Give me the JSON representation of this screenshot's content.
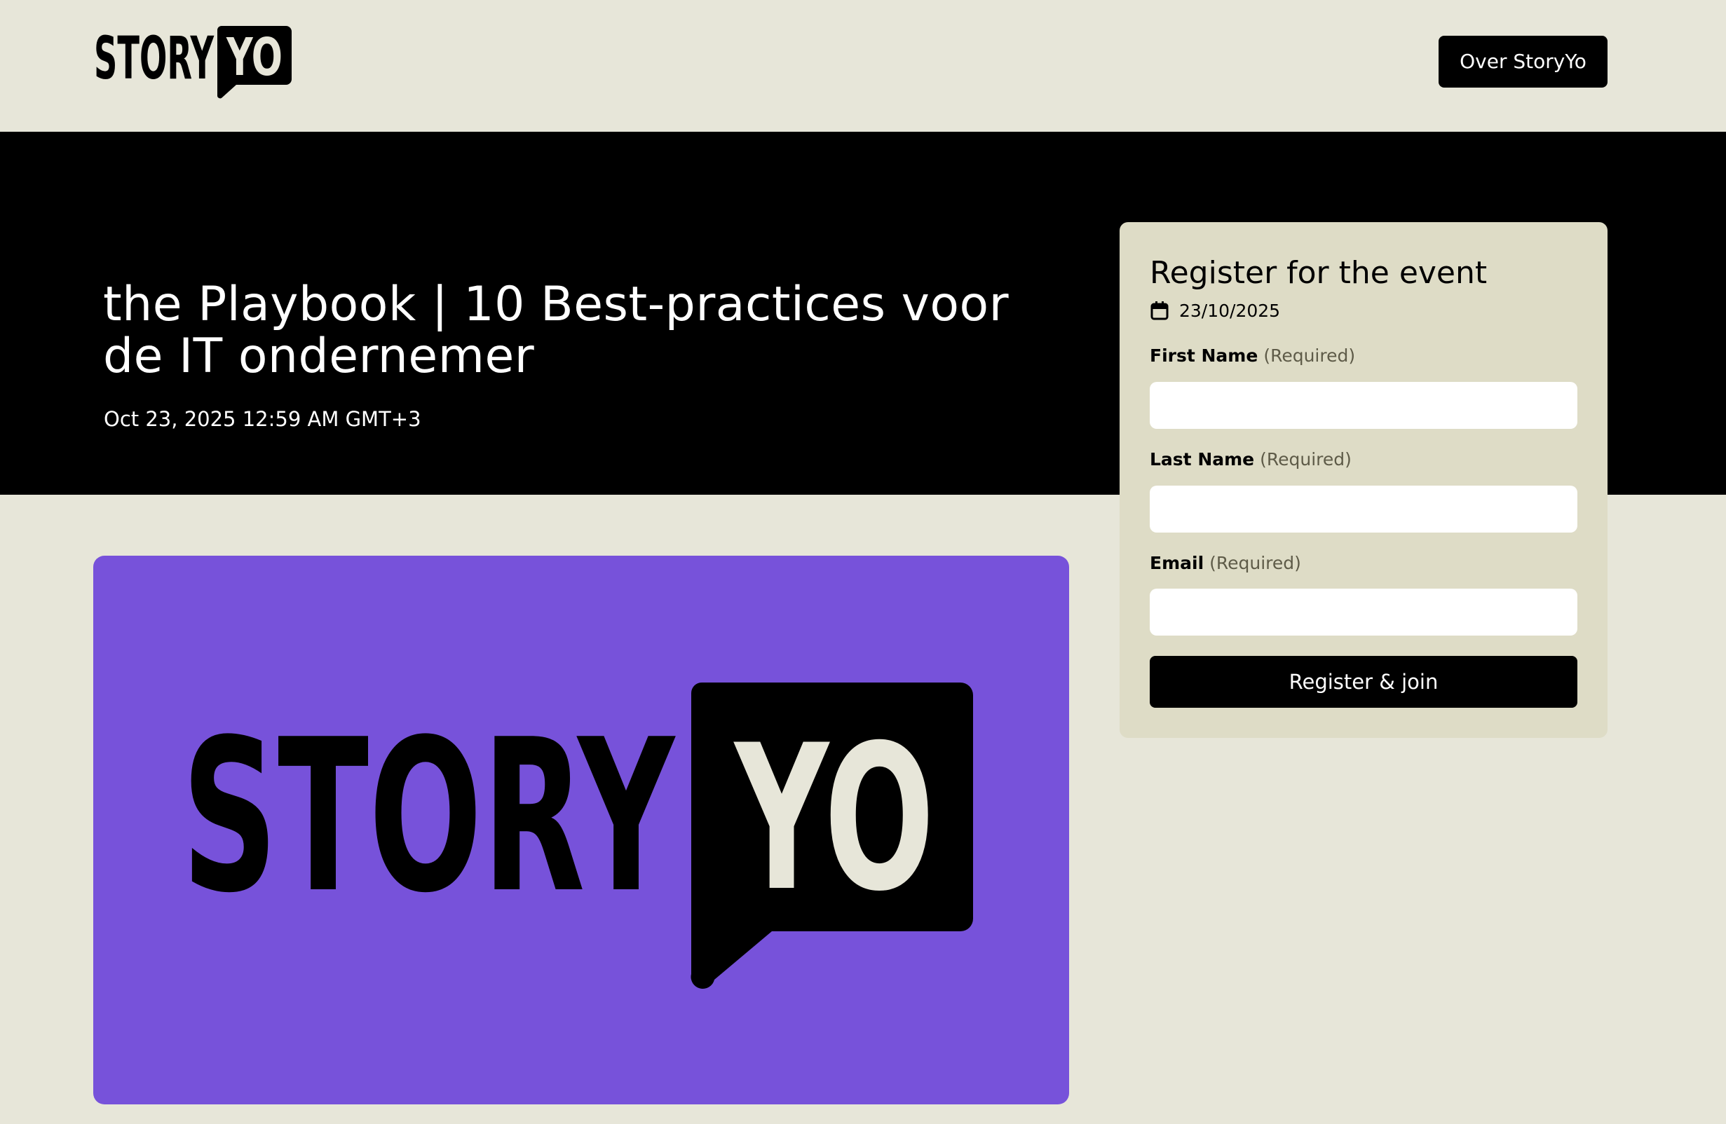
{
  "header": {
    "logo": {
      "part1": "STORY",
      "part2": "YO"
    },
    "about_button": "Over StoryYo"
  },
  "event": {
    "title": "the Playbook | 10 Best-practices voor de IT ondernemer",
    "datetime": "Oct 23, 2025 12:59 AM GMT+3"
  },
  "banner": {
    "logo": {
      "part1": "STORY",
      "part2": "YO"
    },
    "background_color": "#7752da"
  },
  "register": {
    "title": "Register for the event",
    "date": "23/10/2025",
    "date_icon": "calendar-icon",
    "fields": [
      {
        "label": "First Name",
        "required": "(Required)",
        "value": ""
      },
      {
        "label": "Last Name",
        "required": "(Required)",
        "value": ""
      },
      {
        "label": "Email",
        "required": "(Required)",
        "value": ""
      }
    ],
    "submit": "Register & join"
  },
  "colors": {
    "page_background": "#e7e6d9",
    "hero_background": "#000000",
    "card_background": "#dedcc6",
    "button_background": "#000000",
    "logo_yo_text": "#e7e6d9"
  }
}
